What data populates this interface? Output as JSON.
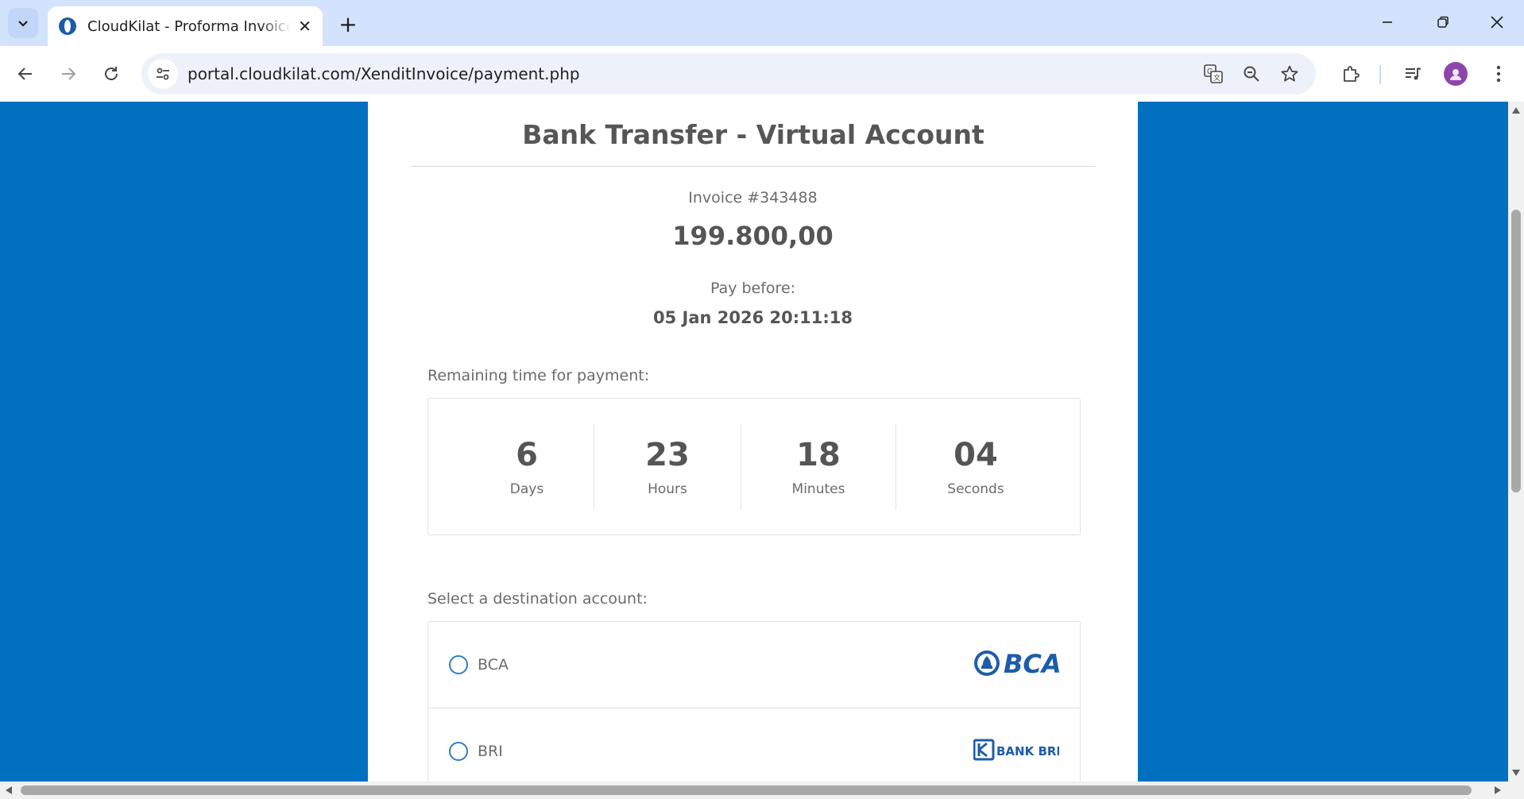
{
  "browser": {
    "tab_title": "CloudKilat - Proforma Invoice #",
    "tab_close": "✕",
    "new_tab": "+",
    "url": "portal.cloudkilat.com/XenditInvoice/payment.php"
  },
  "page": {
    "title": "Bank Transfer - Virtual Account",
    "invoice_label": "Invoice #343488",
    "amount": "199.800,00",
    "pay_before_label": "Pay before:",
    "pay_before_date": "05 Jan 2026 20:11:18",
    "remaining_label": "Remaining time for payment:",
    "countdown": [
      {
        "value": "6",
        "unit": "Days"
      },
      {
        "value": "23",
        "unit": "Hours"
      },
      {
        "value": "18",
        "unit": "Minutes"
      },
      {
        "value": "04",
        "unit": "Seconds"
      }
    ],
    "destination_label": "Select a destination account:",
    "accounts": [
      {
        "label": "BCA",
        "logo_text": "BCA"
      },
      {
        "label": "BRI",
        "logo_text": "BANK BRI"
      }
    ]
  },
  "colors": {
    "page_background": "#0170bf",
    "brand_blue": "#1e5ca8",
    "tabbar": "#d3e3fd"
  }
}
